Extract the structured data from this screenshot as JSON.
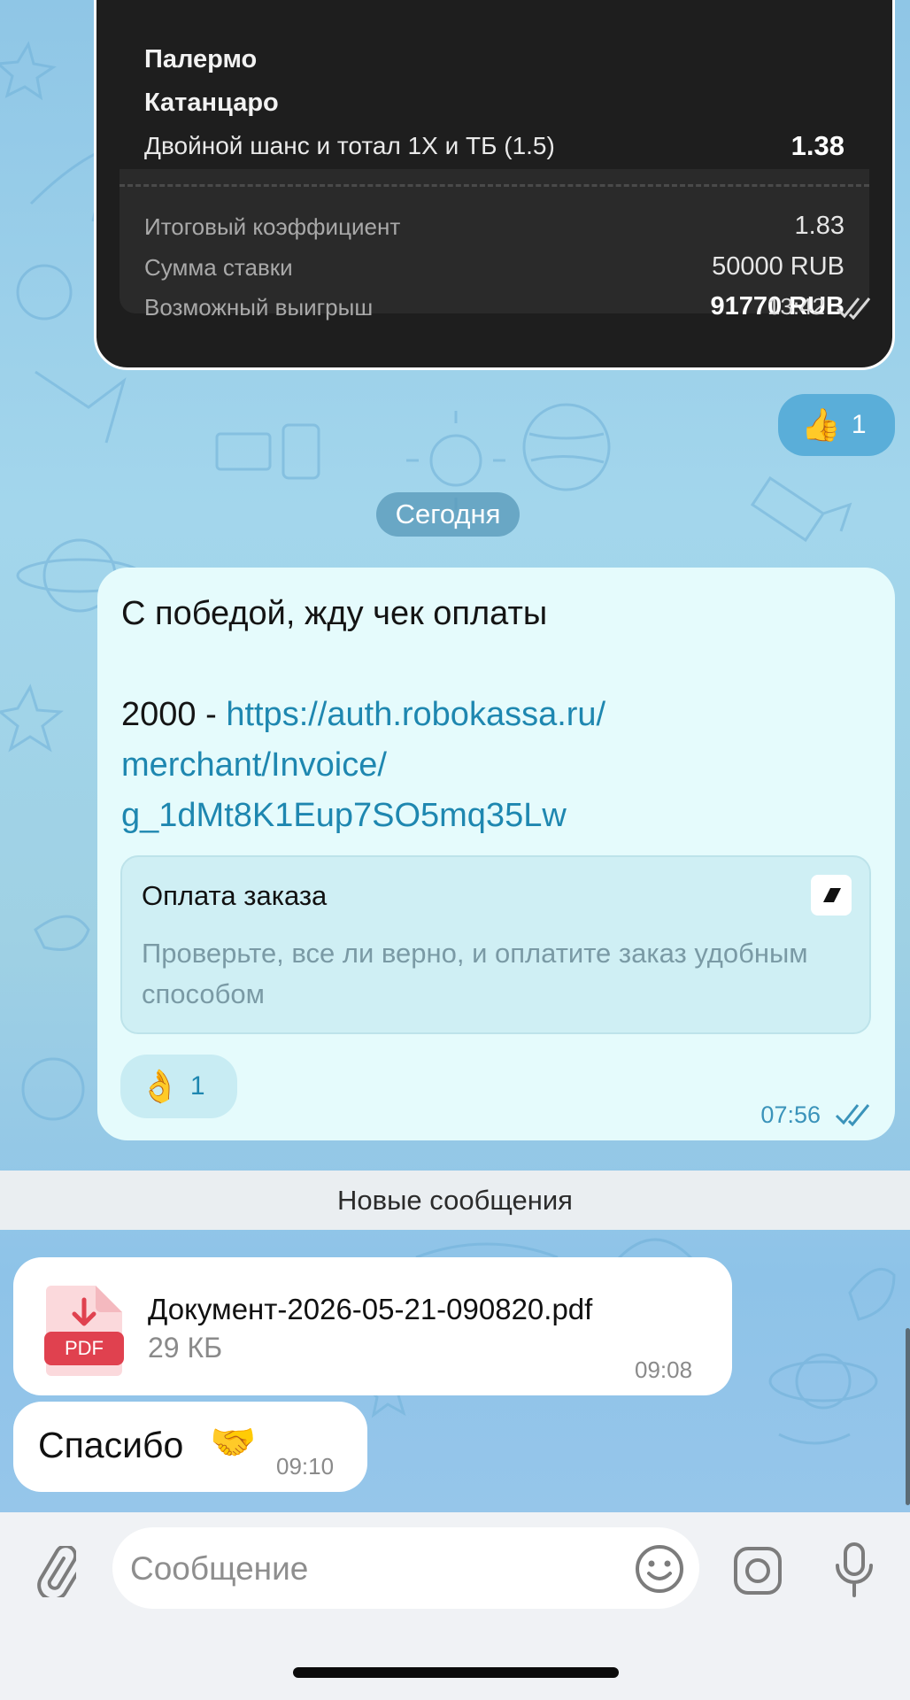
{
  "receipt": {
    "team1": "Палермо",
    "team2": "Катанцаро",
    "bet_line": "Двойной шанс и тотал 1X и ТБ (1.5)",
    "bet_odds": "1.38",
    "total_odds_label": "Итоговый коэффициент",
    "total_odds_value": "1.83",
    "stake_label": "Сумма ставки",
    "stake_value": "50000 RUB",
    "win_label": "Возможный выигрыш",
    "win_value": "91770 RUB",
    "time": "13:42"
  },
  "reaction_thumbs": {
    "emoji": "👍",
    "count": "1"
  },
  "date_separator": "Сегодня",
  "outgoing_message": {
    "text_line1": "С победой, жду чек оплаты",
    "amount": "2000 - ",
    "link": "https://auth.robokassa.ru/merchant/Invoice/g_1dMt8K1Eup7SO5mq35Lw",
    "link_line1": "https://auth.robokassa.ru/",
    "link_line2": "merchant/Invoice/",
    "link_line3": "g_1dMt8K1Eup7SO5mq35Lw",
    "preview_title": "Оплата заказа",
    "preview_description": "Проверьте, все ли верно, и оплатите заказ удобным способом",
    "reaction_emoji": "👌",
    "reaction_count": "1",
    "time": "07:56"
  },
  "new_messages_label": "Новые сообщения",
  "document_message": {
    "icon_label": "PDF",
    "file_name": "Документ-2026-05-21-090820.pdf",
    "file_size": "29 КБ",
    "time": "09:08"
  },
  "thanks_message": {
    "text": "Спасибо",
    "emoji": "🤝",
    "time": "09:10"
  },
  "composer": {
    "placeholder": "Сообщение"
  },
  "colors": {
    "receipt_bg": "#1e1e1e",
    "outgoing_bubble": "#e5fbfc",
    "link": "#1e87b0",
    "pdf_red": "#e0414f",
    "wallpaper": "#9fd1e4"
  }
}
